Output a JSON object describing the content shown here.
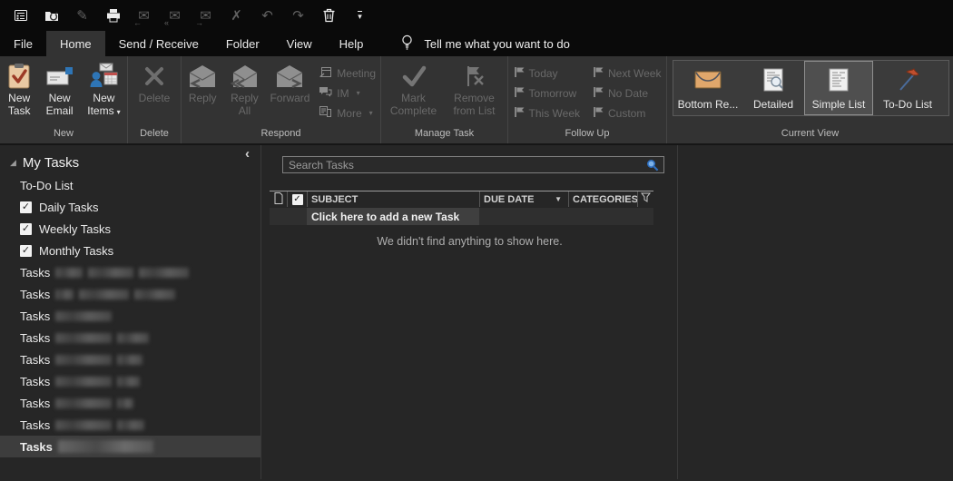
{
  "icons": {
    "caret_down": "▾",
    "chevron_left": "‹",
    "expanded_triangle": "◢",
    "sort_desc": "▼",
    "check": "✓",
    "undo": "↶",
    "redo": "↷",
    "close_x": "✗",
    "envelope": "✉",
    "pencil": "✎",
    "arrow_left": "←",
    "arrow_right": "→",
    "arrow_double_left": "«"
  },
  "qat": {
    "buttons": [
      {
        "name": "view-switcher",
        "enabled": true
      },
      {
        "name": "send-receive-folder",
        "enabled": true
      },
      {
        "name": "save",
        "enabled": false
      },
      {
        "name": "print",
        "enabled": true
      },
      {
        "name": "reply",
        "enabled": false
      },
      {
        "name": "reply-all",
        "enabled": false
      },
      {
        "name": "forward",
        "enabled": false
      },
      {
        "name": "delete",
        "enabled": false
      },
      {
        "name": "undo",
        "enabled": false
      },
      {
        "name": "redo",
        "enabled": false
      },
      {
        "name": "empty-deleted-items",
        "enabled": true
      },
      {
        "name": "customize-quick-access-toolbar",
        "enabled": true
      }
    ]
  },
  "tabs": {
    "file": "File",
    "home": "Home",
    "send_receive": "Send / Receive",
    "folder": "Folder",
    "view": "View",
    "help": "Help",
    "tell_me": "Tell me what you want to do"
  },
  "ribbon": {
    "new_group": {
      "label": "New",
      "new_task": "New Task",
      "new_email": "New Email",
      "new_items": "New Items"
    },
    "delete_group": {
      "label": "Delete",
      "delete": "Delete"
    },
    "respond_group": {
      "label": "Respond",
      "reply": "Reply",
      "reply_all": "Reply All",
      "forward": "Forward",
      "meeting": "Meeting",
      "im": "IM",
      "more": "More"
    },
    "manage_group": {
      "label": "Manage Task",
      "mark_complete": "Mark Complete",
      "remove_from_list": "Remove from List"
    },
    "follow_up_group": {
      "label": "Follow Up",
      "today": "Today",
      "tomorrow": "Tomorrow",
      "this_week": "This Week",
      "next_week": "Next Week",
      "no_date": "No Date",
      "custom": "Custom"
    },
    "current_view_group": {
      "label": "Current View",
      "items": [
        {
          "label": "Bottom Re...",
          "selected": false
        },
        {
          "label": "Detailed",
          "selected": false
        },
        {
          "label": "Simple List",
          "selected": true
        },
        {
          "label": "To-Do List",
          "selected": false
        }
      ]
    }
  },
  "sidebar": {
    "header": "My Tasks",
    "items": [
      {
        "label": "To-Do List",
        "checkbox": false,
        "checked": false
      },
      {
        "label": "Daily Tasks",
        "checkbox": true,
        "checked": true
      },
      {
        "label": "Weekly Tasks",
        "checkbox": true,
        "checked": true
      },
      {
        "label": "Monthly Tasks",
        "checkbox": true,
        "checked": true
      }
    ],
    "task_lists": [
      {
        "label": "Tasks",
        "redacted": true,
        "selected": false
      },
      {
        "label": "Tasks",
        "redacted": true,
        "selected": false
      },
      {
        "label": "Tasks",
        "redacted": true,
        "selected": false
      },
      {
        "label": "Tasks",
        "redacted": true,
        "selected": false
      },
      {
        "label": "Tasks",
        "redacted": true,
        "selected": false
      },
      {
        "label": "Tasks",
        "redacted": true,
        "selected": false
      },
      {
        "label": "Tasks",
        "redacted": true,
        "selected": false
      },
      {
        "label": "Tasks",
        "redacted": true,
        "selected": false
      },
      {
        "label": "Tasks",
        "redacted": true,
        "selected": true
      }
    ]
  },
  "main": {
    "search_placeholder": "Search Tasks",
    "table": {
      "columns": [
        "SUBJECT",
        "DUE DATE",
        "CATEGORIES"
      ],
      "sorted_by": "DUE DATE",
      "sort_direction": "descending"
    },
    "add_row_label": "Click here to add a new Task",
    "empty_message": "We didn't find anything to show here."
  },
  "colors": {
    "ribbon_bg": "#333333",
    "titlebar_bg": "#0a0a0a",
    "content_bg": "#262626",
    "selection_bg": "#3d3d3d",
    "flag_red": "#c14f2e",
    "envelope_orange": "#e0a76b",
    "person_blue": "#2e75b6",
    "clipboard_tan": "#e9c9a3",
    "search_icon_blue": "#2f6fbf"
  }
}
